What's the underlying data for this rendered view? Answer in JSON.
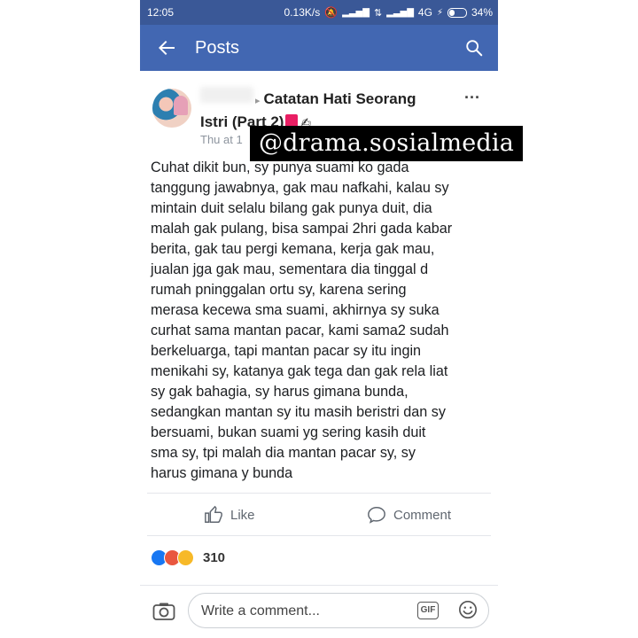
{
  "statusbar": {
    "time": "12:05",
    "speed": "0.13K/s",
    "network": "4G",
    "battery": "34%"
  },
  "appbar": {
    "title": "Posts",
    "back_icon": "arrow-left-icon",
    "search_icon": "search-icon"
  },
  "post": {
    "title_line1": "Catatan Hati Seorang",
    "title_line2": "Istri (Part 2)",
    "timestamp": "Thu at 1",
    "body": "Cuhat dikit bun,  sy punya suami  ko gada\ntanggung jawabnya,  gak mau nafkahi,  kalau sy\nmintain duit selalu bilang gak punya duit,  dia\nmalah gak pulang, bisa sampai 2hri gada kabar\nberita,  gak tau pergi kemana, kerja gak mau,\njualan jga gak mau,  sementara dia tinggal d\nrumah pninggalan ortu sy,  karena sering\nmerasa kecewa sma suami,  akhirnya sy suka\ncurhat sama mantan pacar,  kami sama2 sudah\nberkeluarga,  tapi mantan pacar sy itu ingin\nmenikahi sy,  katanya gak tega dan gak rela liat\nsy gak bahagia,  sy harus gimana bunda,\nsedangkan mantan sy itu masih beristri dan sy\nbersuami,   bukan suami yg sering kasih duit\nsma sy,  tpi malah dia mantan pacar sy,  sy\nharus gimana y bunda"
  },
  "actions": {
    "like": "Like",
    "comment": "Comment"
  },
  "reactions": {
    "count": "310",
    "types": [
      "like",
      "angry",
      "wow"
    ]
  },
  "comment_bar": {
    "placeholder": "Write a comment...",
    "gif": "GIF"
  },
  "watermark": "@drama.sosialmedia"
}
